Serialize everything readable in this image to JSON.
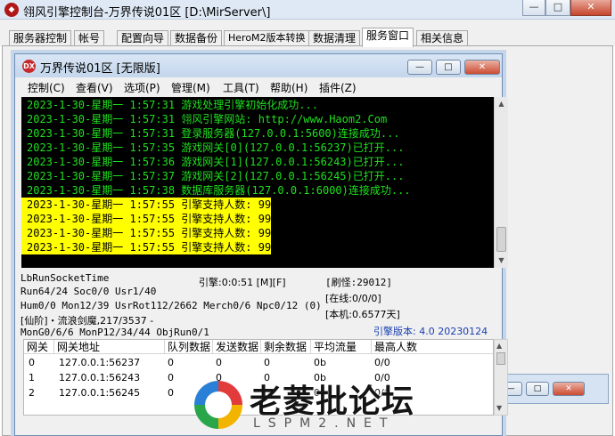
{
  "outer_window": {
    "title": "翎风引擎控制台-万界传说01区 [D:\\MirServer\\]",
    "minimize": "—",
    "maximize": "□",
    "close": "✕"
  },
  "tabs": [
    {
      "label": "服务器控制"
    },
    {
      "label": "帐号"
    },
    {
      "label": "配置向导"
    },
    {
      "label": "数据备份"
    },
    {
      "label": "HeroM2版本转换"
    },
    {
      "label": "数据清理"
    },
    {
      "label": "服务窗口"
    },
    {
      "label": "相关信息"
    }
  ],
  "active_tab": "服务窗口",
  "inner_window": {
    "icon_label": "DX",
    "title": "万界传说01区 [无限版]",
    "minimize": "—",
    "maximize": "□",
    "close": "✕"
  },
  "menu": [
    "控制(C)",
    "查看(V)",
    "选项(P)",
    "管理(M)",
    "工具(T)",
    "帮助(H)",
    "插件(Z)"
  ],
  "log": [
    {
      "text": "2023-1-30-星期一 1:57:31 游戏处理引擎初始化成功...",
      "highlight": false
    },
    {
      "text": "2023-1-30-星期一 1:57:31 翎风引擎网站: http://www.Haom2.Com",
      "highlight": false
    },
    {
      "text": "2023-1-30-星期一 1:57:31 登录服务器(127.0.0.1:5600)连接成功...",
      "highlight": false
    },
    {
      "text": "2023-1-30-星期一 1:57:35 游戏网关[0](127.0.0.1:56237)已打开...",
      "highlight": false
    },
    {
      "text": "2023-1-30-星期一 1:57:36 游戏网关[1](127.0.0.1:56243)已打开...",
      "highlight": false
    },
    {
      "text": "2023-1-30-星期一 1:57:37 游戏网关[2](127.0.0.1:56245)已打开...",
      "highlight": false
    },
    {
      "text": "2023-1-30-星期一 1:57:38 数据库服务器(127.0.0.1:6000)连接成功...",
      "highlight": false
    },
    {
      "text": "2023-1-30-星期一 1:57:55 引擎支持人数: 99",
      "highlight": true
    },
    {
      "text": "2023-1-30-星期一 1:57:55 引擎支持人数: 99",
      "highlight": true
    },
    {
      "text": "2023-1-30-星期一 1:57:55 引擎支持人数: 99",
      "highlight": true
    },
    {
      "text": "2023-1-30-星期一 1:57:55 引擎支持人数: 99",
      "highlight": true
    }
  ],
  "status": {
    "socket": "LbRunSocketTime",
    "run": "Run64/24 Soc0/0 Usr1/40",
    "hum": "Hum0/0 Mon12/39 UsrRot112/2662 Merch0/6 Npc0/12 (0)",
    "xian": "[仙阶]・流浪剑魔,217/3537 -",
    "mon": "MonG0/6/6 MonP12/34/44 ObjRun0/1",
    "engine_time": "引擎:0:0:51 [M][F]",
    "refresh": "[刷怪:29012]",
    "online": "[在线:0/0/0]",
    "local": "[本机:0.6577天]",
    "version": "引擎版本: 4.0 20230124"
  },
  "gateway_table": {
    "headers": [
      "网关",
      "网关地址",
      "队列数据",
      "发送数据",
      "剩余数据",
      "平均流量",
      "最高人数"
    ],
    "rows": [
      [
        "0",
        "127.0.0.1:56237",
        "0",
        "0",
        "0",
        "0b",
        "0/0"
      ],
      [
        "1",
        "127.0.0.1:56243",
        "0",
        "0",
        "0",
        "0b",
        "0/0"
      ],
      [
        "2",
        "127.0.0.1:56245",
        "0",
        "0",
        "0",
        "0b",
        "0/0"
      ]
    ]
  },
  "watermark": {
    "title": "老菱批论坛",
    "sub": "LSPM2.NET"
  },
  "colors": {
    "console_bg": "#000000",
    "console_text": "#1fe01f",
    "highlight_bg": "#ffff00",
    "version_text": "#1a3fb0"
  }
}
